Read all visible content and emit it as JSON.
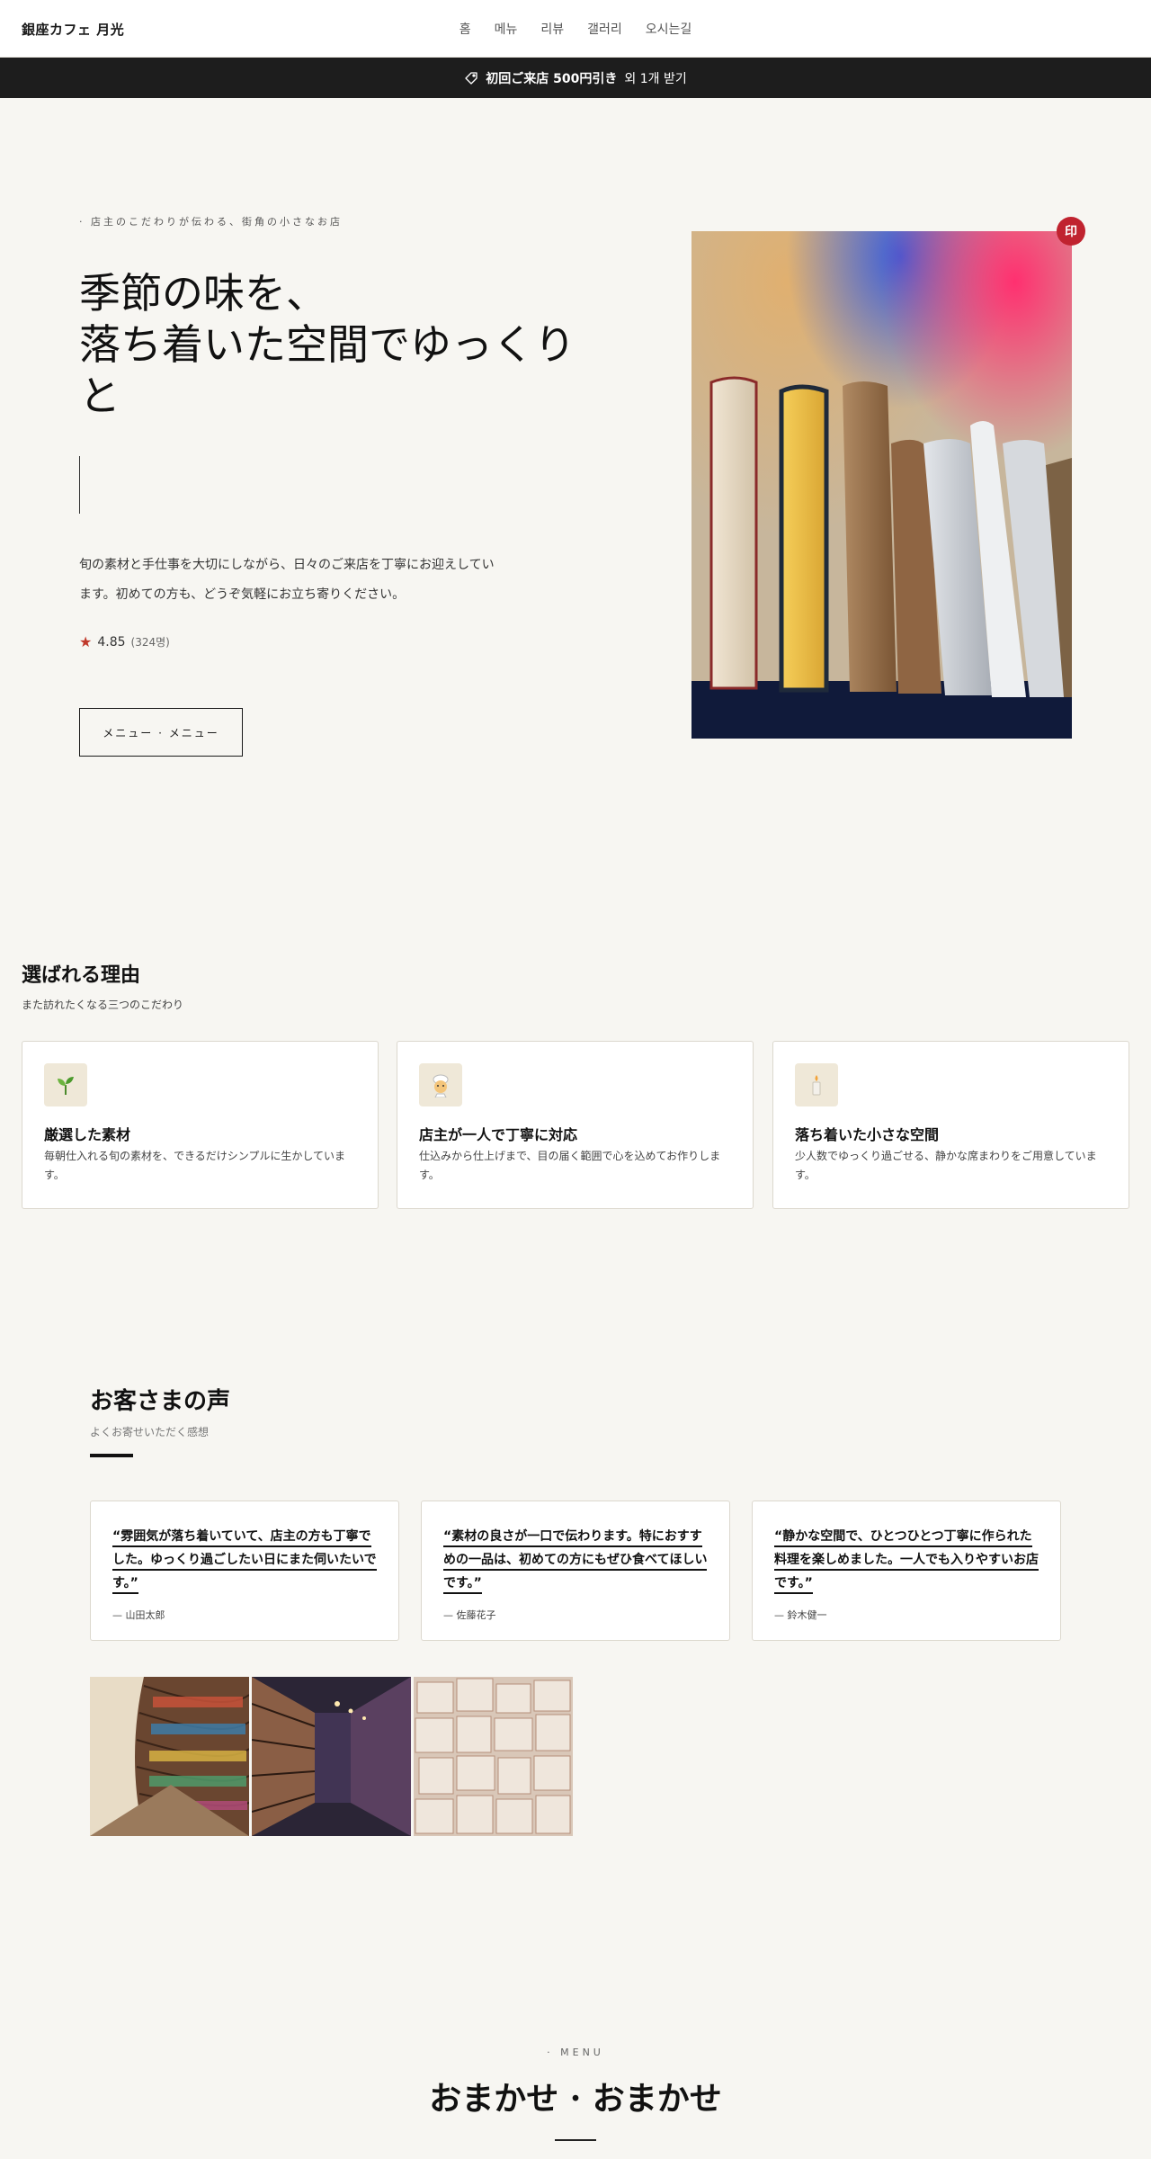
{
  "header": {
    "brand": "銀座カフェ 月光",
    "nav": [
      "홈",
      "메뉴",
      "리뷰",
      "갤러리",
      "오시는길"
    ]
  },
  "promo": {
    "bold": "初回ご来店 500円引き",
    "rest": "외 1개 받기"
  },
  "hero": {
    "kicker": "· 店主のこだわりが伝わる、街角の小さなお店",
    "title_line1": "季節の味を、",
    "title_line2": "落ち着いた空間でゆっくり",
    "title_line3": "と",
    "description": "旬の素材と手仕事を大切にしながら、日々のご来店を丁寧にお迎えしています。初めての方も、どうぞ気軽にお立ち寄りください。",
    "rating": "4.85",
    "rating_count": "(324명)",
    "cta": "メニュー · メニュー",
    "stamp": "印"
  },
  "reasons": {
    "title": "選ばれる理由",
    "subtitle": "また訪れたくなる三つのこだわり",
    "items": [
      {
        "icon": "seedling-icon",
        "title": "厳選した素材",
        "desc": "毎朝仕入れる旬の素材を、できるだけシンプルに生かしています。"
      },
      {
        "icon": "chef-icon",
        "title": "店主が一人で丁寧に対応",
        "desc": "仕込みから仕上げまで、目の届く範囲で心を込めてお作りします。"
      },
      {
        "icon": "candle-icon",
        "title": "落ち着いた小さな空間",
        "desc": "少人数でゆっくり過ごせる、静かな席まわりをご用意しています。"
      }
    ]
  },
  "testimonials": {
    "title": "お客さまの声",
    "subtitle": "よくお寄せいただく感想",
    "items": [
      {
        "quote": "“雰囲気が落ち着いていて、店主の方も丁寧でした。ゆっくり過ごしたい日にまた伺いたいです。”",
        "author": "— 山田太郎"
      },
      {
        "quote": "“素材の良さが一口で伝わります。特におすすめの一品は、初めての方にもぜひ食べてほしいです。”",
        "author": "— 佐藤花子"
      },
      {
        "quote": "“静かな空間で、ひとつひとつ丁寧に作られた料理を楽しめました。一人でも入りやすいお店です。”",
        "author": "— 鈴木健一"
      }
    ]
  },
  "menu": {
    "kicker": "· MENU",
    "title": "おまかせ · おまかせ"
  },
  "colors": {
    "accent": "#c0232f",
    "background": "#f7f6f2",
    "promo_bar": "#1d1d1d"
  }
}
